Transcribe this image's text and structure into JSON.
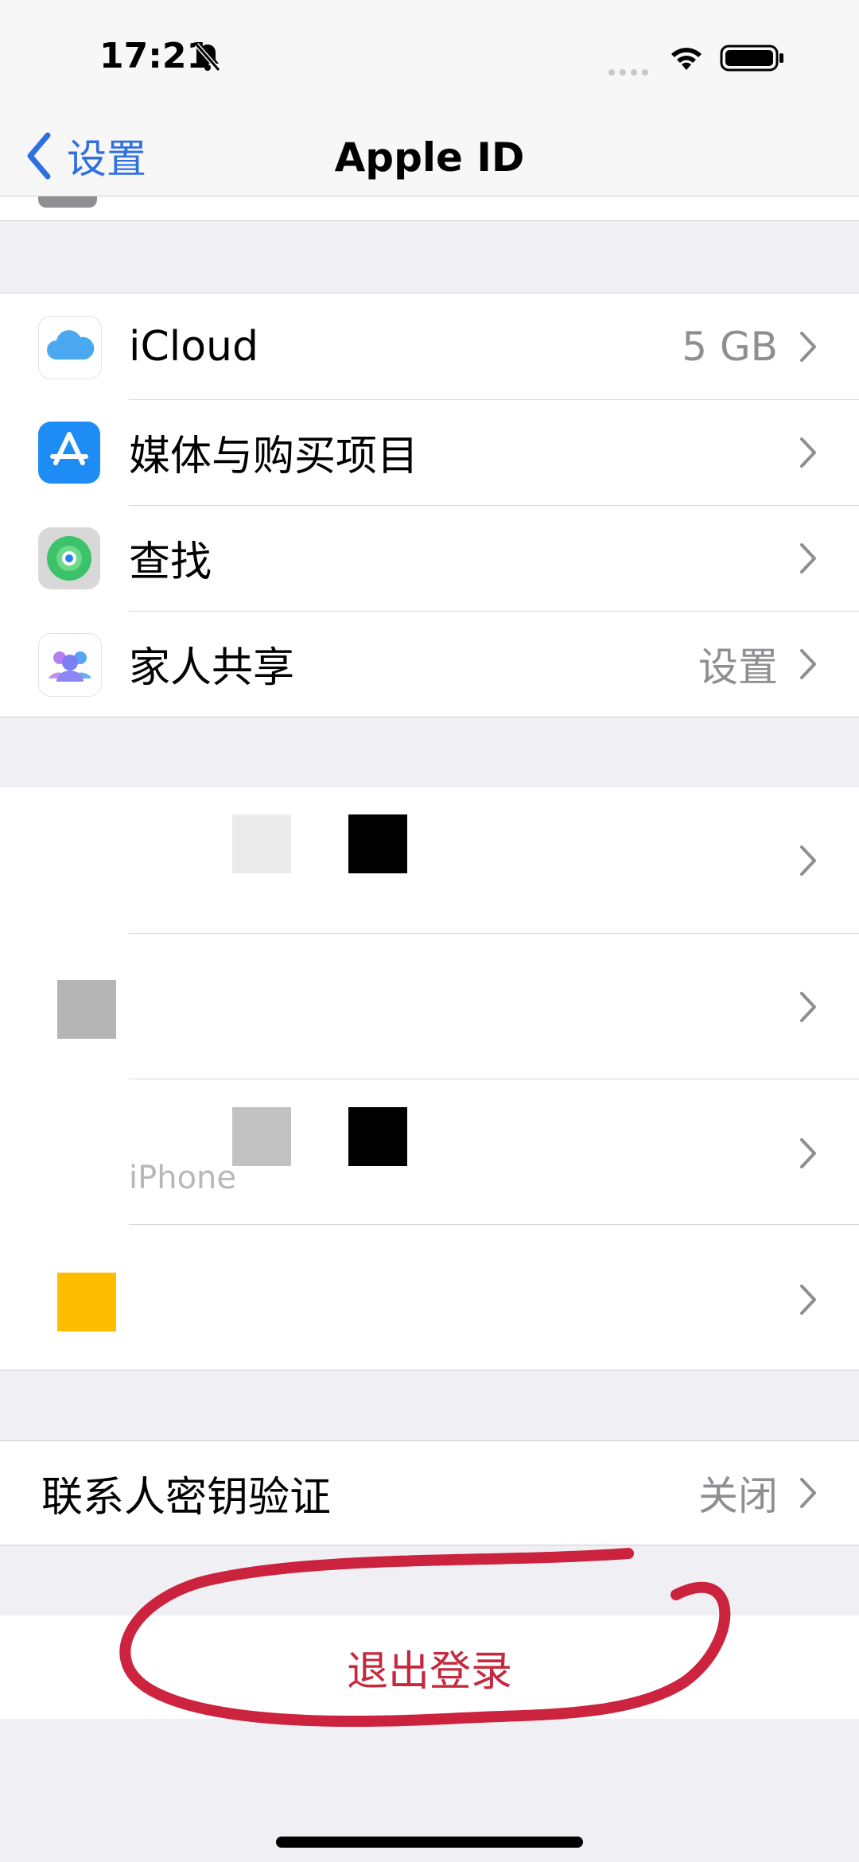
{
  "status_bar": {
    "time": "17:21"
  },
  "nav": {
    "back_label": "设置",
    "title": "Apple ID"
  },
  "services": [
    {
      "label": "iCloud",
      "value": "5 GB",
      "icon": "icloud-icon"
    },
    {
      "label": "媒体与购买项目",
      "value": "",
      "icon": "app-store-icon"
    },
    {
      "label": "查找",
      "value": "",
      "icon": "find-my-icon"
    },
    {
      "label": "家人共享",
      "value": "设置",
      "icon": "family-sharing-icon"
    }
  ],
  "devices": [
    {
      "label": ""
    },
    {
      "label": ""
    },
    {
      "label": "iPhone"
    },
    {
      "label": ""
    }
  ],
  "contact_key": {
    "label": "联系人密钥验证",
    "value": "关闭"
  },
  "sign_out": {
    "label": "退出登录"
  },
  "colors": {
    "accent": "#2f6fdf",
    "destructive": "#c6283d",
    "annotation": "#c8102e"
  }
}
